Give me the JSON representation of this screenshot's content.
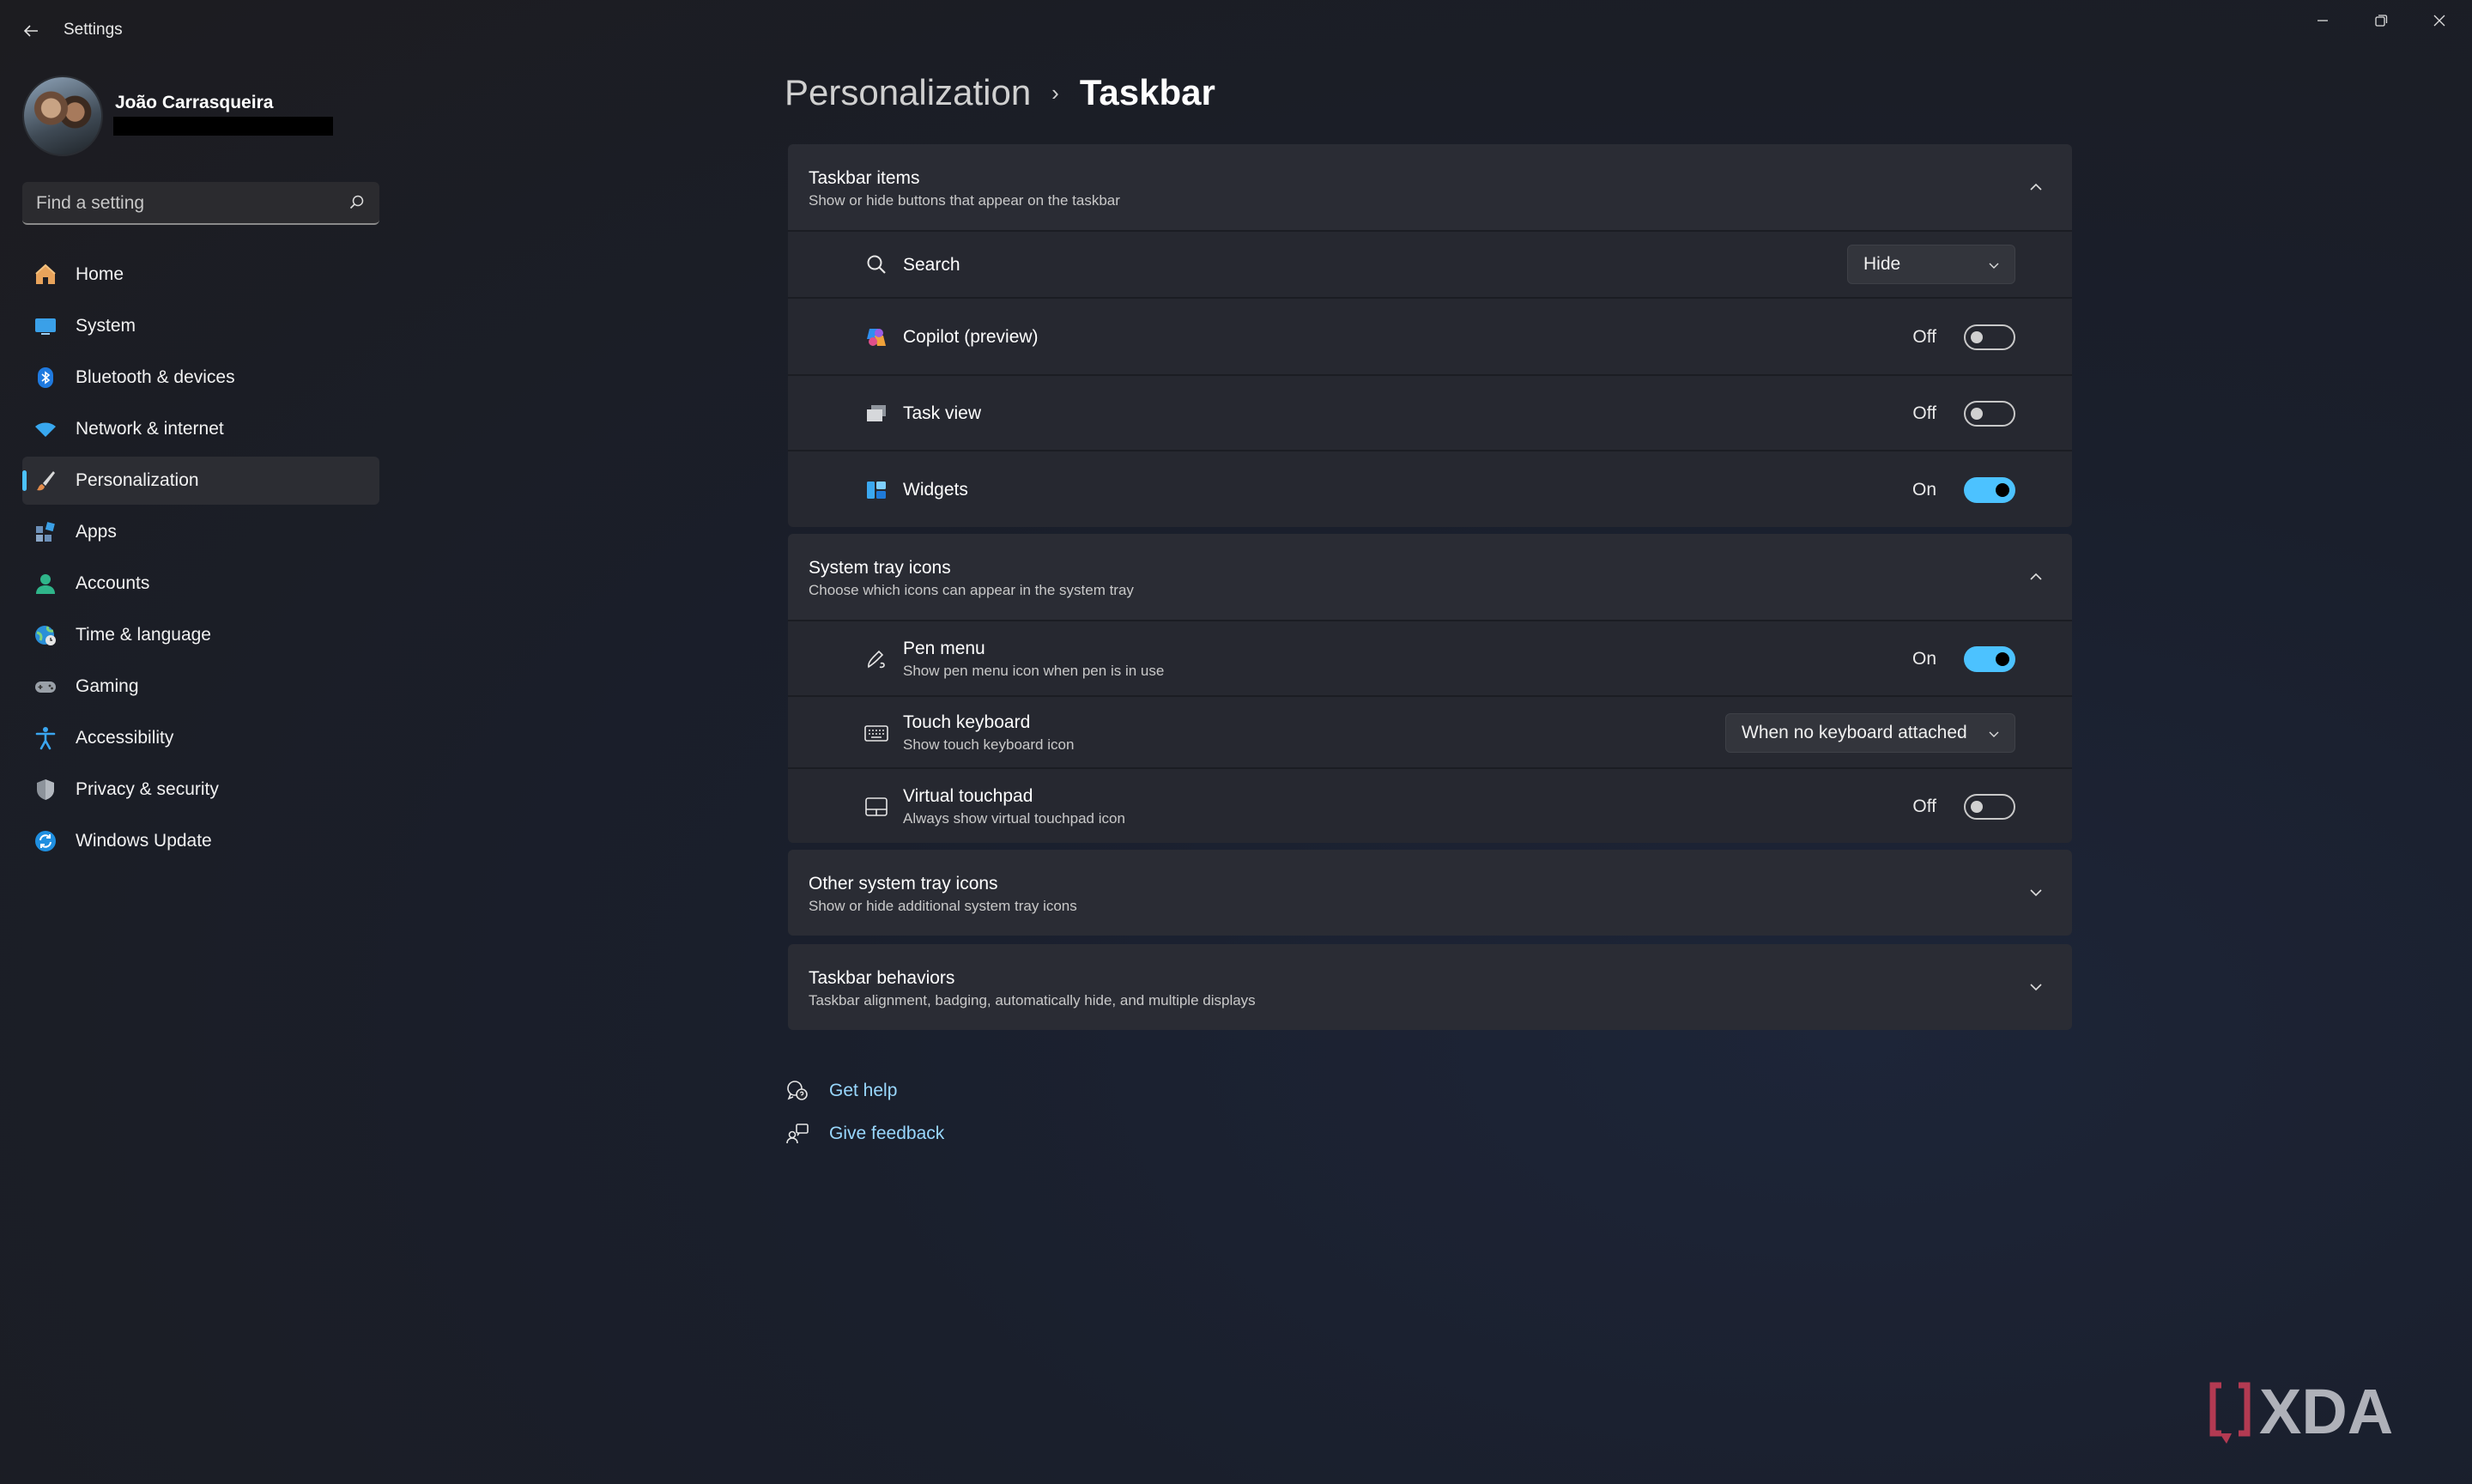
{
  "window": {
    "title": "Settings"
  },
  "profile": {
    "name": "João Carrasqueira"
  },
  "search": {
    "placeholder": "Find a setting"
  },
  "sidebar": {
    "items": [
      {
        "label": "Home",
        "icon": "home-icon",
        "active": false
      },
      {
        "label": "System",
        "icon": "system-monitor-icon",
        "active": false
      },
      {
        "label": "Bluetooth & devices",
        "icon": "bluetooth-icon",
        "active": false
      },
      {
        "label": "Network & internet",
        "icon": "wifi-icon",
        "active": false
      },
      {
        "label": "Personalization",
        "icon": "brush-icon",
        "active": true
      },
      {
        "label": "Apps",
        "icon": "apps-icon",
        "active": false
      },
      {
        "label": "Accounts",
        "icon": "person-icon",
        "active": false
      },
      {
        "label": "Time & language",
        "icon": "globe-clock-icon",
        "active": false
      },
      {
        "label": "Gaming",
        "icon": "gamepad-icon",
        "active": false
      },
      {
        "label": "Accessibility",
        "icon": "accessibility-icon",
        "active": false
      },
      {
        "label": "Privacy & security",
        "icon": "shield-icon",
        "active": false
      },
      {
        "label": "Windows Update",
        "icon": "update-icon",
        "active": false
      }
    ]
  },
  "breadcrumb": {
    "parent": "Personalization",
    "separator": "›",
    "current": "Taskbar"
  },
  "taskbar_items": {
    "title": "Taskbar items",
    "subtitle": "Show or hide buttons that appear on the taskbar",
    "rows": [
      {
        "label": "Search",
        "icon": "search-icon",
        "control": "dropdown",
        "value": "Hide"
      },
      {
        "label": "Copilot (preview)",
        "icon": "copilot-icon",
        "control": "toggle",
        "state": "Off"
      },
      {
        "label": "Task view",
        "icon": "task-view-icon",
        "control": "toggle",
        "state": "Off"
      },
      {
        "label": "Widgets",
        "icon": "widgets-icon",
        "control": "toggle",
        "state": "On"
      }
    ]
  },
  "system_tray": {
    "title": "System tray icons",
    "subtitle": "Choose which icons can appear in the system tray",
    "rows": [
      {
        "label": "Pen menu",
        "sub": "Show pen menu icon when pen is in use",
        "icon": "pen-icon",
        "control": "toggle",
        "state": "On"
      },
      {
        "label": "Touch keyboard",
        "sub": "Show touch keyboard icon",
        "icon": "keyboard-icon",
        "control": "dropdown",
        "value": "When no keyboard attached"
      },
      {
        "label": "Virtual touchpad",
        "sub": "Always show virtual touchpad icon",
        "icon": "touchpad-icon",
        "control": "toggle",
        "state": "Off"
      }
    ]
  },
  "other_tray": {
    "title": "Other system tray icons",
    "subtitle": "Show or hide additional system tray icons"
  },
  "behaviors": {
    "title": "Taskbar behaviors",
    "subtitle": "Taskbar alignment, badging, automatically hide, and multiple displays"
  },
  "links": {
    "help": "Get help",
    "feedback": "Give feedback"
  },
  "colors": {
    "accent": "#4cc2ff",
    "link": "#99d8ff"
  },
  "watermark": {
    "brand": "XDA"
  }
}
